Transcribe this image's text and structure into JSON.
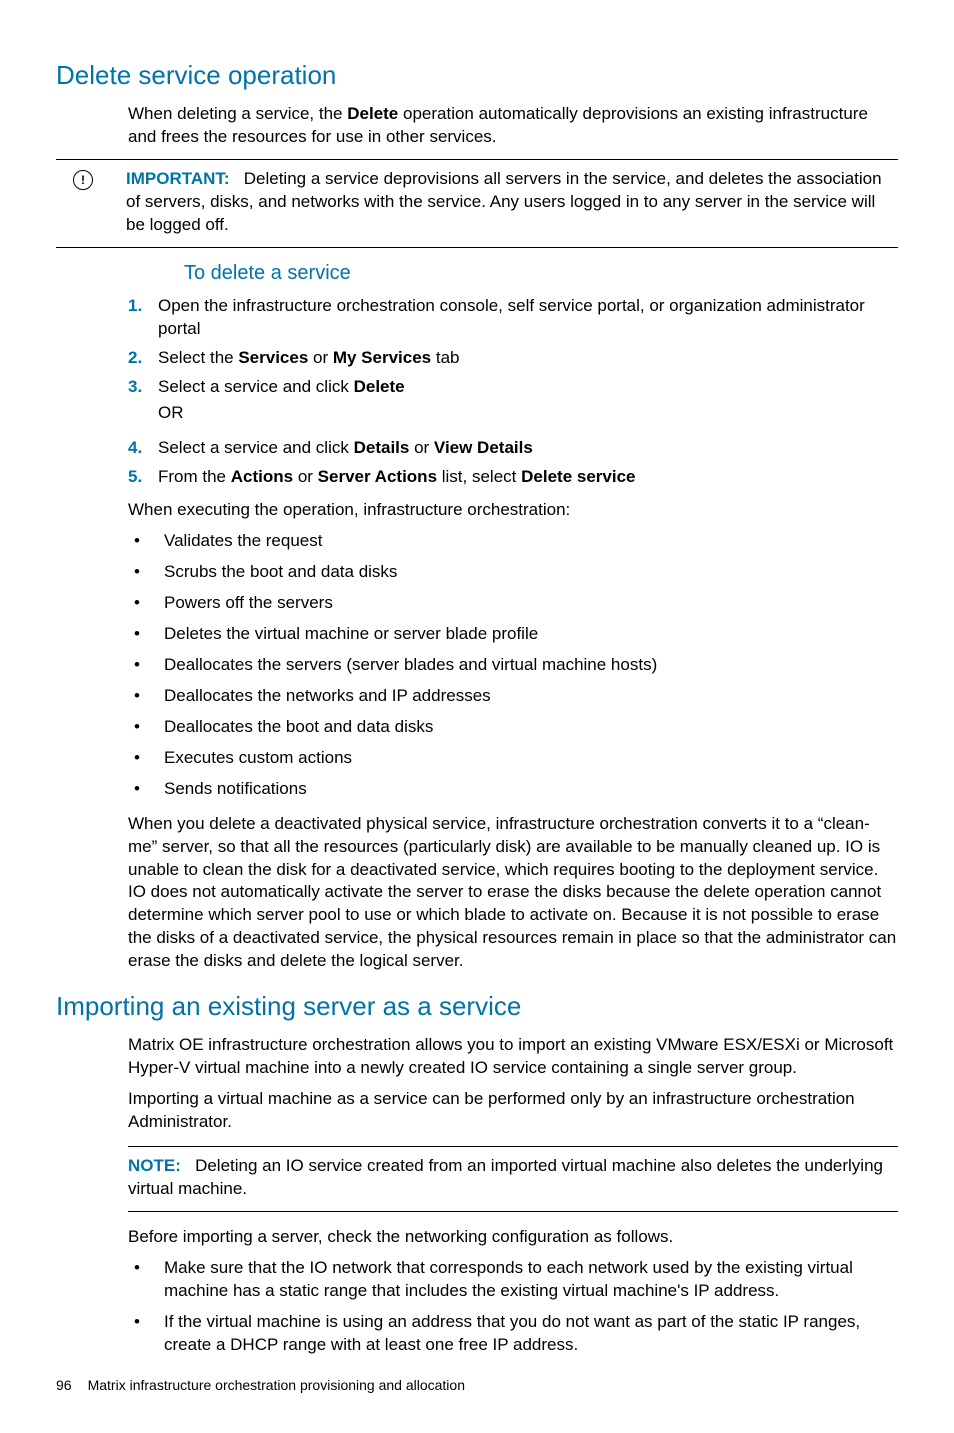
{
  "heading1": "Delete service operation",
  "intro_before": "When deleting a service, the ",
  "intro_bold": "Delete",
  "intro_after": " operation automatically deprovisions an existing infrastructure and frees the resources for use in other services.",
  "important_label": "IMPORTANT:",
  "important_text": "Deleting a service deprovisions all servers in the service, and deletes the association of servers, disks, and networks with the service. Any users logged in to any server in the service will be logged off.",
  "proc_heading": "To delete a service",
  "steps": {
    "s1": "Open the infrastructure orchestration console, self service portal, or organization administrator portal",
    "s2_a": "Select the ",
    "s2_b1": "Services",
    "s2_mid": " or ",
    "s2_b2": "My Services",
    "s2_c": " tab",
    "s3_a": "Select a service and click ",
    "s3_b": "Delete",
    "or": "OR",
    "s4_a": "Select a service and click ",
    "s4_b1": "Details",
    "s4_mid": " or ",
    "s4_b2": "View Details",
    "s5_a": "From the ",
    "s5_b1": "Actions",
    "s5_mid": " or ",
    "s5_b2": "Server Actions",
    "s5_c": " list, select ",
    "s5_b3": "Delete service"
  },
  "exec_para": "When executing the operation, infrastructure orchestration:",
  "exec_bullets": [
    "Validates the request",
    "Scrubs the boot and data disks",
    "Powers off the servers",
    "Deletes the virtual machine or server blade profile",
    "Deallocates the servers (server blades and virtual machine hosts)",
    "Deallocates the networks and IP addresses",
    "Deallocates the boot and data disks",
    "Executes custom actions",
    "Sends notifications"
  ],
  "clean_para": "When you delete a deactivated physical service, infrastructure orchestration converts it to a “clean-me” server, so that all the resources (particularly disk) are available to be manually cleaned up. IO is unable to clean the disk for a deactivated service, which requires booting to the deployment service. IO does not automatically activate the server to erase the disks because the delete operation cannot determine which server pool to use or which blade to activate on. Because it is not possible to erase the disks of a deactivated service, the physical resources remain in place so that the administrator can erase the disks and delete the logical server.",
  "heading2": "Importing an existing server as a service",
  "import_p1": "Matrix OE infrastructure orchestration allows you to import an existing VMware ESX/ESXi or Microsoft Hyper-V virtual machine into a newly created IO service containing a single server group.",
  "import_p2": "Importing a virtual machine as a service can be performed only by an infrastructure orchestration Administrator.",
  "note_label": "NOTE:",
  "note_text": "Deleting an IO service created from an imported virtual machine also deletes the underlying virtual machine.",
  "before_para": "Before importing a server, check the networking configuration as follows.",
  "net_bullets": [
    "Make sure that the IO network that corresponds to each network used by the existing virtual machine has a static range that includes the existing virtual machine's IP address.",
    "If the virtual machine is using an address that you do not want as part of the static IP ranges, create a DHCP range with at least one free IP address."
  ],
  "footer_page": "96",
  "footer_title": "Matrix infrastructure orchestration provisioning and allocation"
}
